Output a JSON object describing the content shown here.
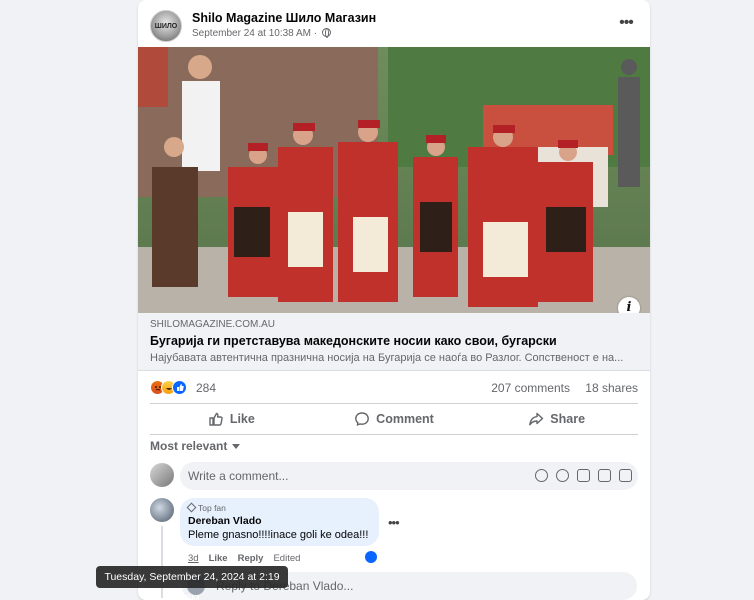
{
  "post": {
    "page_avatar_text": "ШИЛО",
    "page_name": "Shilo Magazine Шило Магазин",
    "time": "September 24 at 10:38 AM ·",
    "more": "•••",
    "info_icon": "i"
  },
  "link": {
    "domain": "SHILOMAGAZINE.COM.AU",
    "title": "Бугарија ги претставува македонските носии како свои, бугарски",
    "description": "Најубавата автентична празнична носија на Бугарија се наоѓа во Разлог. Сопственост е на..."
  },
  "stats": {
    "reactions": "284",
    "comments": "207 comments",
    "shares": "18 shares",
    "reaction_icons": [
      "angry-icon",
      "haha-icon",
      "like-icon"
    ]
  },
  "actions": {
    "like": "Like",
    "comment": "Comment",
    "share": "Share"
  },
  "sort": {
    "label": "Most relevant"
  },
  "composer": {
    "placeholder": "Write a comment...",
    "icons": [
      "avatar-sticker-icon",
      "emoji-icon",
      "camera-icon",
      "gif-icon",
      "sticker-icon"
    ]
  },
  "comment": {
    "badge": "Top fan",
    "author": "Dereban Vlado",
    "text": "Pleme gnasno!!!!inace goli ke odea!!!",
    "time": "3d",
    "like": "Like",
    "reply": "Reply",
    "edited": "Edited",
    "more": "•••"
  },
  "reply": {
    "placeholder": "Reply to Dereban Vlado..."
  },
  "tooltip": {
    "text": "Tuesday, September 24, 2024 at 2:19 PM"
  },
  "colors": {
    "accent": "#0866ff",
    "secondary_text": "#65676b",
    "bubble": "#e7f0fd"
  }
}
